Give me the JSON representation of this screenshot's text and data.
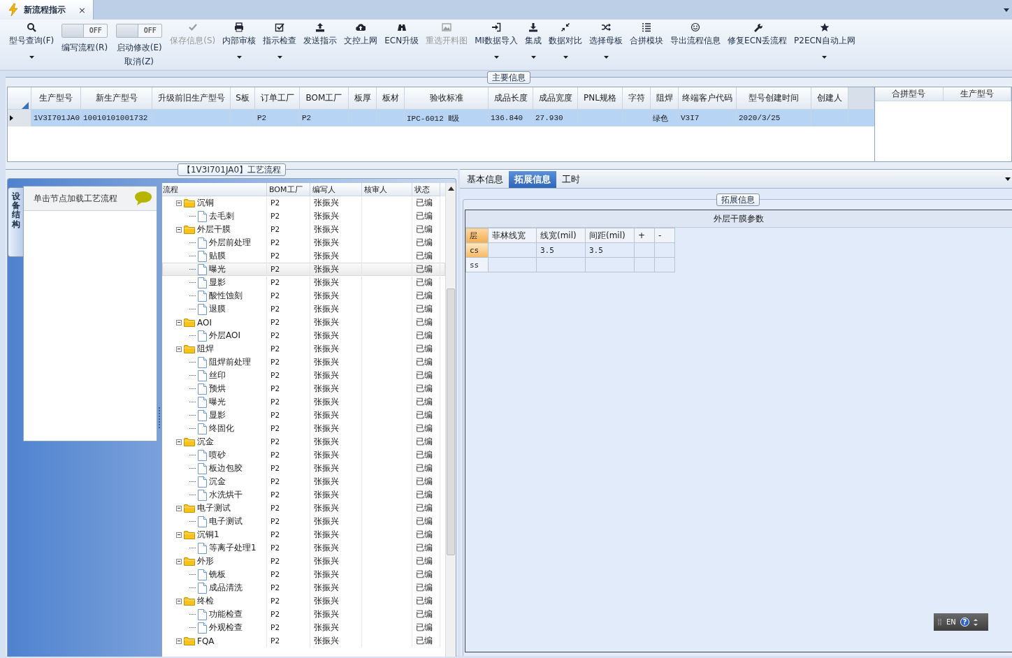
{
  "document_tab": {
    "title": "新流程指示",
    "close": "×",
    "selected": true
  },
  "ribbon": [
    {
      "kind": "button",
      "label": "型号查询(F)",
      "disabled": false,
      "dropdown": true
    },
    {
      "kind": "toggle",
      "label": "编写流程(R)",
      "toggle_text": "OFF",
      "on": false
    },
    {
      "kind": "toggle",
      "label": "启动修改(E)",
      "sublabel": "取消(Z)",
      "toggle_text": "OFF",
      "on": false
    },
    {
      "kind": "button",
      "label": "保存信息(S)",
      "disabled": true,
      "dropdown": false
    },
    {
      "kind": "button",
      "label": "内部审核",
      "disabled": false,
      "dropdown": true
    },
    {
      "kind": "button",
      "label": "指示检查",
      "disabled": false,
      "dropdown": true
    },
    {
      "kind": "button",
      "label": "发送指示",
      "disabled": false,
      "dropdown": false
    },
    {
      "kind": "button",
      "label": "文控上网",
      "disabled": false,
      "dropdown": false
    },
    {
      "kind": "button",
      "label": "ECN升级",
      "disabled": false,
      "dropdown": false
    },
    {
      "kind": "button",
      "label": "重选开料图",
      "disabled": true,
      "dropdown": false
    },
    {
      "kind": "button",
      "label": "MI数据导入",
      "disabled": false,
      "dropdown": true
    },
    {
      "kind": "button",
      "label": "集成",
      "disabled": false,
      "dropdown": true
    },
    {
      "kind": "button",
      "label": "数据对比",
      "disabled": false,
      "dropdown": true
    },
    {
      "kind": "button",
      "label": "选择母板",
      "disabled": false,
      "dropdown": true
    },
    {
      "kind": "button",
      "label": "合拼模块",
      "disabled": false,
      "dropdown": false
    },
    {
      "kind": "button",
      "label": "导出流程信息",
      "disabled": false,
      "dropdown": false
    },
    {
      "kind": "button",
      "label": "修复ECN丢流程",
      "disabled": false,
      "dropdown": false
    },
    {
      "kind": "button",
      "label": "P2ECN自动上网",
      "disabled": false,
      "dropdown": true
    }
  ],
  "main_info": {
    "title": "主要信息",
    "columns": [
      "生产型号",
      "新生产型号",
      "升级前旧生产型号",
      "S板",
      "订单工厂",
      "BOM工厂",
      "板厚",
      "板材",
      "验收标准",
      "成品长度",
      "成品宽度",
      "PNL规格",
      "字符",
      "阻焊",
      "终端客户代码",
      "型号创建时间",
      "创建人"
    ],
    "rows": [
      {
        "selected": true,
        "cells": [
          "1V3I701JA0",
          "10010101001732",
          null,
          null,
          "P2",
          "P2",
          null,
          null,
          "IPC-6012 Ⅱ级",
          "136.840",
          "27.930",
          null,
          null,
          "绿色",
          "V3I7",
          "2020/3/25",
          null
        ]
      }
    ],
    "side_columns": [
      "合拼型号",
      "生产型号"
    ]
  },
  "process": {
    "title": "【1V3I701JA0】工艺流程",
    "side_tab": "设备结构",
    "hint": "单击节点加载工艺流程",
    "columns": [
      "流程",
      "BOM工厂",
      "编写人",
      "核审人",
      "状态"
    ],
    "tree": [
      {
        "name": "沉铜",
        "bom": "P2",
        "writer": "张振兴",
        "status": "已编",
        "selected": false,
        "expanded": true,
        "children": [
          {
            "name": "去毛刺",
            "bom": "P2",
            "writer": "张振兴",
            "status": "已编",
            "selected": false
          }
        ]
      },
      {
        "name": "外层干膜",
        "bom": "P2",
        "writer": "张振兴",
        "status": "已编",
        "selected": false,
        "expanded": true,
        "children": [
          {
            "name": "外层前处理",
            "bom": "P2",
            "writer": "张振兴",
            "status": "已编",
            "selected": false
          },
          {
            "name": "贴膜",
            "bom": "P2",
            "writer": "张振兴",
            "status": "已编",
            "selected": false
          },
          {
            "name": "曝光",
            "bom": "P2",
            "writer": "张振兴",
            "status": "已编",
            "selected": true
          },
          {
            "name": "显影",
            "bom": "P2",
            "writer": "张振兴",
            "status": "已编",
            "selected": false
          },
          {
            "name": "酸性蚀刻",
            "bom": "P2",
            "writer": "张振兴",
            "status": "已编",
            "selected": false
          },
          {
            "name": "退膜",
            "bom": "P2",
            "writer": "张振兴",
            "status": "已编",
            "selected": false
          }
        ]
      },
      {
        "name": "AOI",
        "bom": "P2",
        "writer": "张振兴",
        "status": "已编",
        "selected": false,
        "expanded": true,
        "children": [
          {
            "name": "外层AOI",
            "bom": "P2",
            "writer": "张振兴",
            "status": "已编",
            "selected": false
          }
        ]
      },
      {
        "name": "阻焊",
        "bom": "P2",
        "writer": "张振兴",
        "status": "已编",
        "selected": false,
        "expanded": true,
        "children": [
          {
            "name": "阻焊前处理",
            "bom": "P2",
            "writer": "张振兴",
            "status": "已编",
            "selected": false
          },
          {
            "name": "丝印",
            "bom": "P2",
            "writer": "张振兴",
            "status": "已编",
            "selected": false
          },
          {
            "name": "预烘",
            "bom": "P2",
            "writer": "张振兴",
            "status": "已编",
            "selected": false
          },
          {
            "name": "曝光",
            "bom": "P2",
            "writer": "张振兴",
            "status": "已编",
            "selected": false
          },
          {
            "name": "显影",
            "bom": "P2",
            "writer": "张振兴",
            "status": "已编",
            "selected": false
          },
          {
            "name": "终固化",
            "bom": "P2",
            "writer": "张振兴",
            "status": "已编",
            "selected": false
          }
        ]
      },
      {
        "name": "沉金",
        "bom": "P2",
        "writer": "张振兴",
        "status": "已编",
        "selected": false,
        "expanded": true,
        "children": [
          {
            "name": "喷砂",
            "bom": "P2",
            "writer": "张振兴",
            "status": "已编",
            "selected": false
          },
          {
            "name": "板边包胶",
            "bom": "P2",
            "writer": "张振兴",
            "status": "已编",
            "selected": false
          },
          {
            "name": "沉金",
            "bom": "P2",
            "writer": "张振兴",
            "status": "已编",
            "selected": false
          },
          {
            "name": "水洗烘干",
            "bom": "P2",
            "writer": "张振兴",
            "status": "已编",
            "selected": false
          }
        ]
      },
      {
        "name": "电子测试",
        "bom": "P2",
        "writer": "张振兴",
        "status": "已编",
        "selected": false,
        "expanded": true,
        "children": [
          {
            "name": "电子测试",
            "bom": "P2",
            "writer": "张振兴",
            "status": "已编",
            "selected": false
          }
        ]
      },
      {
        "name": "沉铜1",
        "bom": "P2",
        "writer": "张振兴",
        "status": "已编",
        "selected": false,
        "expanded": true,
        "children": [
          {
            "name": "等离子处理1",
            "bom": "P2",
            "writer": "张振兴",
            "status": "已编",
            "selected": false
          }
        ]
      },
      {
        "name": "外形",
        "bom": "P2",
        "writer": "张振兴",
        "status": "已编",
        "selected": false,
        "expanded": true,
        "children": [
          {
            "name": "铣板",
            "bom": "P2",
            "writer": "张振兴",
            "status": "已编",
            "selected": false
          },
          {
            "name": "成品清洗",
            "bom": "P2",
            "writer": "张振兴",
            "status": "已编",
            "selected": false
          }
        ]
      },
      {
        "name": "终检",
        "bom": "P2",
        "writer": "张振兴",
        "status": "已编",
        "selected": false,
        "expanded": true,
        "children": [
          {
            "name": "功能检查",
            "bom": "P2",
            "writer": "张振兴",
            "status": "已编",
            "selected": false
          },
          {
            "name": "外观检查",
            "bom": "P2",
            "writer": "张振兴",
            "status": "已编",
            "selected": false
          }
        ]
      },
      {
        "name": "FQA",
        "bom": "P2",
        "writer": "张振兴",
        "status": "已编",
        "selected": false,
        "expanded": true
      }
    ]
  },
  "detail": {
    "tabs": [
      {
        "label": "基本信息",
        "selected": false
      },
      {
        "label": "拓展信息",
        "selected": true
      },
      {
        "label": "工时",
        "selected": false
      }
    ],
    "group_title": "拓展信息",
    "table": {
      "title": "外层干膜参数",
      "columns": [
        "层",
        "菲林线宽",
        "线宽(mil)",
        "间距(mil)",
        "+",
        "-"
      ],
      "rows": [
        {
          "selected": true,
          "cells": [
            "cs",
            null,
            "3.5",
            "3.5",
            null,
            null
          ]
        },
        {
          "selected": false,
          "cells": [
            "ss",
            null,
            null,
            null,
            null,
            null
          ]
        }
      ]
    }
  },
  "ime": {
    "label": "EN",
    "help": "?"
  }
}
